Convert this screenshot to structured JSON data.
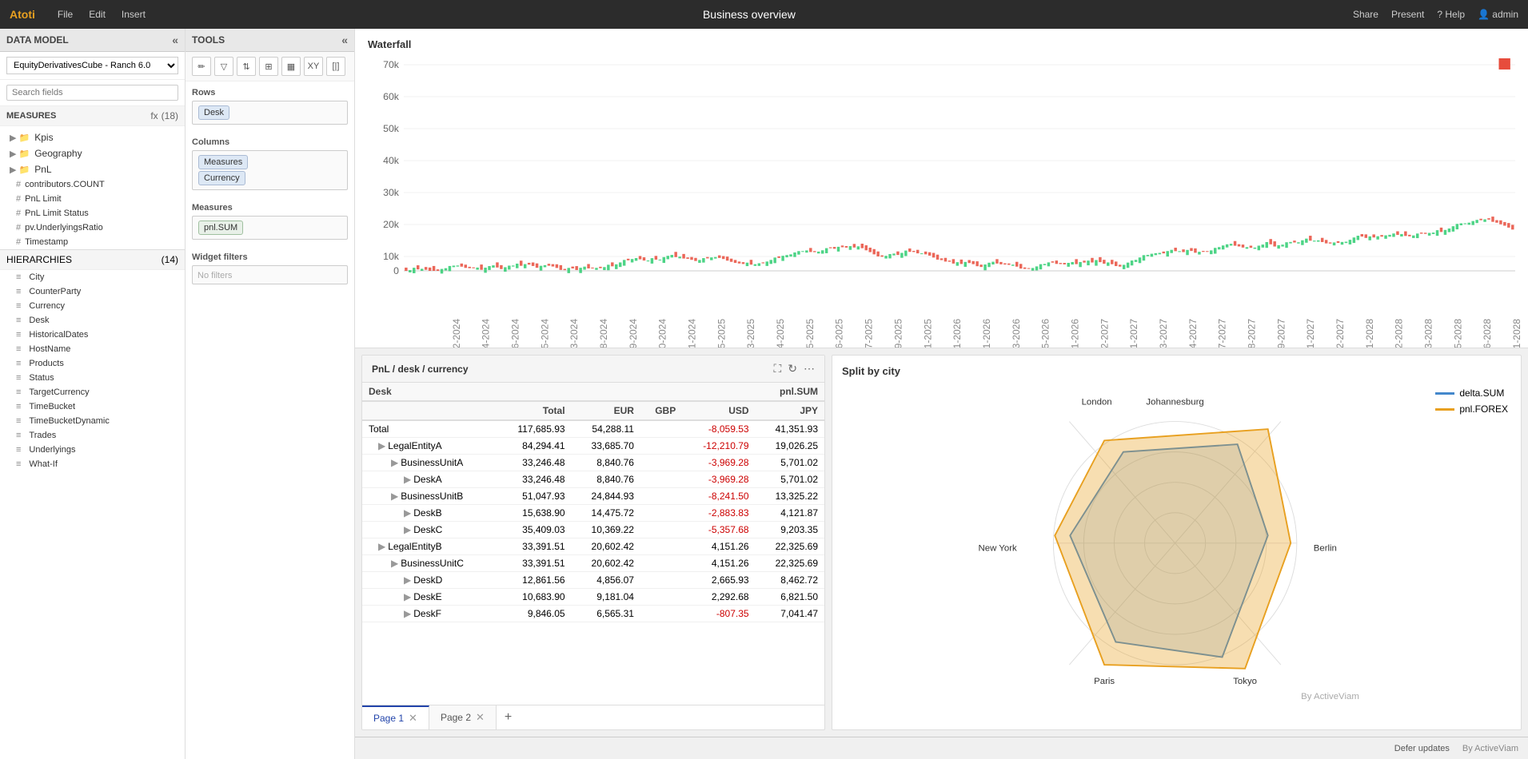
{
  "app": {
    "logo": "Atoti",
    "menu": [
      "File",
      "Edit",
      "Insert"
    ],
    "title": "Business overview",
    "right_actions": [
      "Share",
      "Present",
      "?  Help",
      "admin"
    ]
  },
  "left_panel": {
    "header": "DATA MODEL",
    "model_selector": "EquityDerivativesCube - Ranch 6.0",
    "search_placeholder": "Search fields",
    "measures_label": "MEASURES",
    "fx_label": "fx",
    "count_label": "(18)",
    "measures_groups": [
      {
        "name": "Kpis",
        "type": "folder"
      },
      {
        "name": "Geography",
        "type": "folder"
      },
      {
        "name": "PnL",
        "type": "folder"
      }
    ],
    "measures_items": [
      "contributors.COUNT",
      "PnL Limit",
      "PnL Limit Status",
      "pv.UnderlyingsRatio",
      "Timestamp"
    ],
    "hierarchies_label": "HIERARCHIES",
    "hierarchies_count": "(14)",
    "hierarchies_items": [
      "City",
      "CounterParty",
      "Currency",
      "Desk",
      "HistoricalDates",
      "HostName",
      "Products",
      "Status",
      "TargetCurrency",
      "TimeBucket",
      "TimeBucketDynamic",
      "Trades",
      "Underlyings",
      "What-If"
    ]
  },
  "tools_panel": {
    "header": "TOOLS",
    "toolbar_buttons": [
      "pencil",
      "filter",
      "sort",
      "pivot",
      "grid",
      "xy",
      "split"
    ],
    "rows_label": "Rows",
    "rows_tags": [
      "Desk"
    ],
    "columns_label": "Columns",
    "columns_tags": [
      "Measures",
      "Currency"
    ],
    "measures_label": "Measures",
    "measures_tags": [
      "pnl.SUM"
    ],
    "widget_filters_label": "Widget filters",
    "no_filters": "No filters"
  },
  "waterfall": {
    "title": "Waterfall",
    "y_labels": [
      "70k",
      "60k",
      "50k",
      "40k",
      "30k",
      "20k",
      "10k",
      "0"
    ],
    "color_positive": "#2ecc71",
    "color_negative": "#e74c3c",
    "indicator_color": "#e74c3c"
  },
  "table_panel": {
    "title": "PnL / desk / currency",
    "columns": {
      "desk": "Desk",
      "pnl": "pnl.SUM",
      "sub_total": "Total",
      "eur": "EUR",
      "gbp": "GBP",
      "usd": "USD",
      "jpy": "JPY"
    },
    "rows": [
      {
        "label": "Total",
        "indent": 0,
        "total": "117,685.93",
        "eur": "54,288.11",
        "gbp": "",
        "usd": "-8,059.53",
        "usd_neg": true,
        "jpy": "41,351.93"
      },
      {
        "label": "LegalEntityA",
        "indent": 1,
        "total": "84,294.41",
        "eur": "33,685.70",
        "gbp": "",
        "usd": "-12,210.79",
        "usd_neg": true,
        "jpy": "19,026.25"
      },
      {
        "label": "BusinessUnitA",
        "indent": 2,
        "total": "33,246.48",
        "eur": "8,840.76",
        "gbp": "",
        "usd": "-3,969.28",
        "usd_neg": true,
        "jpy": "5,701.02"
      },
      {
        "label": "DeskA",
        "indent": 3,
        "total": "33,246.48",
        "eur": "8,840.76",
        "gbp": "",
        "usd": "-3,969.28",
        "usd_neg": true,
        "jpy": "5,701.02"
      },
      {
        "label": "BusinessUnitB",
        "indent": 2,
        "total": "51,047.93",
        "eur": "24,844.93",
        "gbp": "",
        "usd": "-8,241.50",
        "usd_neg": true,
        "jpy": "13,325.22"
      },
      {
        "label": "DeskB",
        "indent": 3,
        "total": "15,638.90",
        "eur": "14,475.72",
        "gbp": "",
        "usd": "-2,883.83",
        "usd_neg": true,
        "jpy": "4,121.87"
      },
      {
        "label": "DeskC",
        "indent": 3,
        "total": "35,409.03",
        "eur": "10,369.22",
        "gbp": "",
        "usd": "-5,357.68",
        "usd_neg": true,
        "jpy": "9,203.35"
      },
      {
        "label": "LegalEntityB",
        "indent": 1,
        "total": "33,391.51",
        "eur": "20,602.42",
        "gbp": "",
        "usd": "4,151.26",
        "usd_neg": false,
        "jpy": "22,325.69"
      },
      {
        "label": "BusinessUnitC",
        "indent": 2,
        "total": "33,391.51",
        "eur": "20,602.42",
        "gbp": "",
        "usd": "4,151.26",
        "usd_neg": false,
        "jpy": "22,325.69"
      },
      {
        "label": "DeskD",
        "indent": 3,
        "total": "12,861.56",
        "eur": "4,856.07",
        "gbp": "",
        "usd": "2,665.93",
        "usd_neg": false,
        "jpy": "8,462.72"
      },
      {
        "label": "DeskE",
        "indent": 3,
        "total": "10,683.90",
        "eur": "9,181.04",
        "gbp": "",
        "usd": "2,292.68",
        "usd_neg": false,
        "jpy": "6,821.50"
      },
      {
        "label": "DeskF",
        "indent": 3,
        "total": "9,846.05",
        "eur": "6,565.31",
        "gbp": "",
        "usd": "-807.35",
        "usd_neg": true,
        "jpy": "7,041.47"
      }
    ],
    "pages": [
      "Page 1",
      "Page 2"
    ],
    "active_page": 0
  },
  "radar_panel": {
    "title": "Split by city",
    "cities": [
      "London",
      "Johannesburg",
      "Berlin",
      "Tokyo",
      "Paris",
      "New York"
    ],
    "legend": [
      {
        "name": "delta.SUM",
        "color": "#4488cc"
      },
      {
        "name": "pnl.FOREX",
        "color": "#e8a020"
      }
    ],
    "by_label": "By ActiveViam"
  },
  "bottom_bar": {
    "defer_updates": "Defer updates",
    "by_activeviam": "By ActiveViam"
  }
}
